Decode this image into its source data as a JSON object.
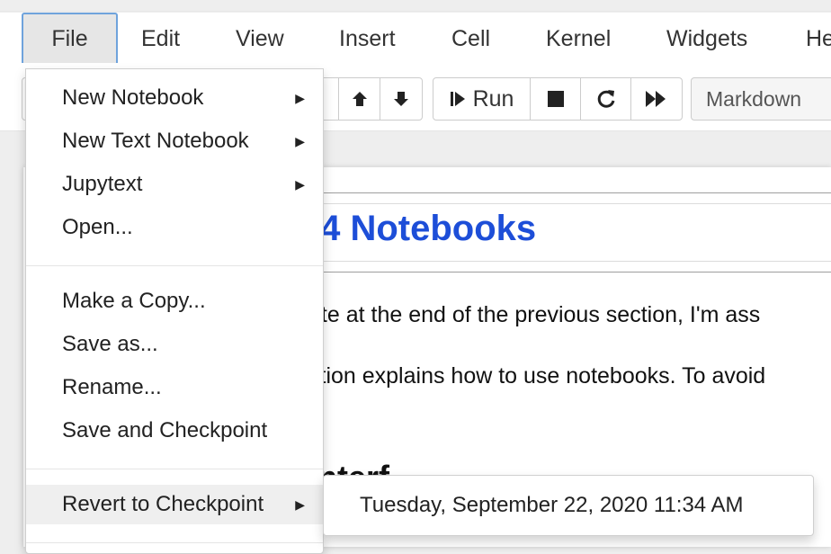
{
  "menubar": {
    "items": [
      {
        "label": "File"
      },
      {
        "label": "Edit"
      },
      {
        "label": "View"
      },
      {
        "label": "Insert"
      },
      {
        "label": "Cell"
      },
      {
        "label": "Kernel"
      },
      {
        "label": "Widgets"
      },
      {
        "label": "He"
      }
    ]
  },
  "toolbar": {
    "run_label": "Run",
    "cell_type": "Markdown"
  },
  "notebook": {
    "heading": ".4 Notebooks",
    "para1": "ote at the end of the previous section, I'm ass",
    "para2": "ction explains how to use notebooks. To avoid",
    "sub_heading": "Interf"
  },
  "file_menu": {
    "items": [
      {
        "label": "New Notebook",
        "submenu": true
      },
      {
        "label": "New Text Notebook",
        "submenu": true
      },
      {
        "label": "Jupytext",
        "submenu": true
      },
      {
        "label": "Open..."
      },
      {
        "label": "Make a Copy..."
      },
      {
        "label": "Save as..."
      },
      {
        "label": "Rename..."
      },
      {
        "label": "Save and Checkpoint"
      },
      {
        "label": "Revert to Checkpoint",
        "submenu": true
      }
    ]
  },
  "checkpoint_submenu": {
    "item": "Tuesday, September 22, 2020 11:34 AM"
  },
  "colors": {
    "heading": "#1d4ed8",
    "active_border": "#6fa3dc"
  }
}
